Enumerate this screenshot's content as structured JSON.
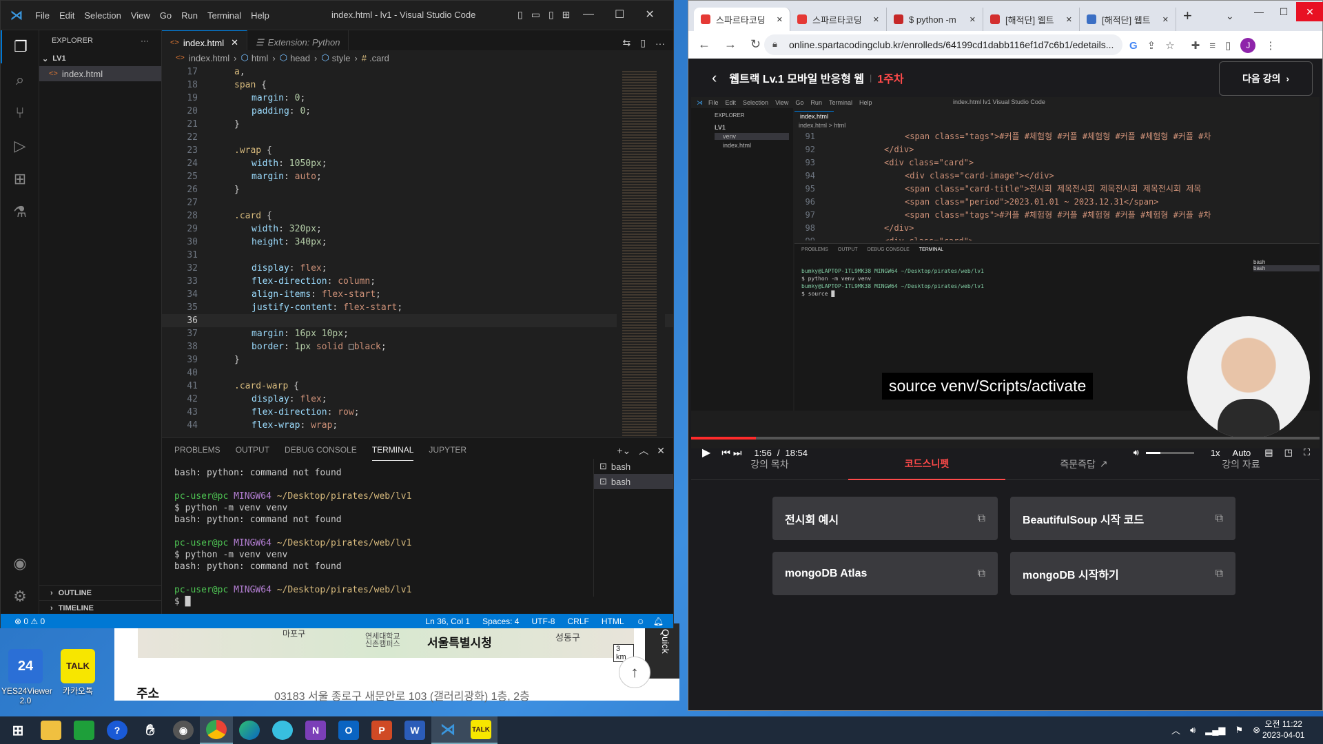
{
  "desktop": {
    "icons": [
      {
        "label": "YES24Viewer\n2.0"
      },
      {
        "label": "카카오톡"
      }
    ]
  },
  "mapwin": {
    "map_labels": [
      "마포구",
      "연세대학교\n신촌캠퍼스",
      "서울특별시청",
      "성동구",
      "3 km"
    ],
    "address_label": "주소",
    "address_value": "03183  서울 종로구 새문안로 103 (갤러리광화)  1층, 2층",
    "quick_label": "Quick"
  },
  "vscode": {
    "title": "index.html - lv1 - Visual Studio Code",
    "menu": [
      "File",
      "Edit",
      "Selection",
      "View",
      "Go",
      "Run",
      "Terminal",
      "Help"
    ],
    "explorer_label": "EXPLORER",
    "folder": "LV1",
    "file": "index.html",
    "outline": "OUTLINE",
    "timeline": "TIMELINE",
    "tabs": [
      {
        "label": "index.html"
      },
      {
        "label": "Extension: Python"
      }
    ],
    "breadcrumb": [
      "index.html",
      "html",
      "head",
      "style",
      ".card"
    ],
    "code_lines": [
      {
        "n": "17",
        "parts": [
          [
            "a",
            "sel"
          ],
          [
            ",",
            "pun"
          ]
        ],
        "indent": 1
      },
      {
        "n": "18",
        "parts": [
          [
            "span",
            "sel"
          ],
          [
            " {",
            "pun"
          ]
        ],
        "indent": 1
      },
      {
        "n": "19",
        "parts": [
          [
            "margin",
            "prop"
          ],
          [
            ": ",
            "pun"
          ],
          [
            "0",
            "num"
          ],
          [
            ";",
            "pun"
          ]
        ],
        "indent": 2
      },
      {
        "n": "20",
        "parts": [
          [
            "padding",
            "prop"
          ],
          [
            ": ",
            "pun"
          ],
          [
            "0",
            "num"
          ],
          [
            ";",
            "pun"
          ]
        ],
        "indent": 2
      },
      {
        "n": "21",
        "parts": [
          [
            "}",
            "pun"
          ]
        ],
        "indent": 1
      },
      {
        "n": "22",
        "parts": [],
        "indent": 0
      },
      {
        "n": "23",
        "parts": [
          [
            ".wrap",
            "sel"
          ],
          [
            " {",
            "pun"
          ]
        ],
        "indent": 1
      },
      {
        "n": "24",
        "parts": [
          [
            "width",
            "prop"
          ],
          [
            ": ",
            "pun"
          ],
          [
            "1050px",
            "num"
          ],
          [
            ";",
            "pun"
          ]
        ],
        "indent": 2
      },
      {
        "n": "25",
        "parts": [
          [
            "margin",
            "prop"
          ],
          [
            ": ",
            "pun"
          ],
          [
            "auto",
            "val"
          ],
          [
            ";",
            "pun"
          ]
        ],
        "indent": 2
      },
      {
        "n": "26",
        "parts": [
          [
            "}",
            "pun"
          ]
        ],
        "indent": 1
      },
      {
        "n": "27",
        "parts": [],
        "indent": 0
      },
      {
        "n": "28",
        "parts": [
          [
            ".card",
            "sel"
          ],
          [
            " {",
            "pun"
          ]
        ],
        "indent": 1
      },
      {
        "n": "29",
        "parts": [
          [
            "width",
            "prop"
          ],
          [
            ": ",
            "pun"
          ],
          [
            "320px",
            "num"
          ],
          [
            ";",
            "pun"
          ]
        ],
        "indent": 2
      },
      {
        "n": "30",
        "parts": [
          [
            "height",
            "prop"
          ],
          [
            ": ",
            "pun"
          ],
          [
            "340px",
            "num"
          ],
          [
            ";",
            "pun"
          ]
        ],
        "indent": 2
      },
      {
        "n": "31",
        "parts": [],
        "indent": 0
      },
      {
        "n": "32",
        "parts": [
          [
            "display",
            "prop"
          ],
          [
            ": ",
            "pun"
          ],
          [
            "flex",
            "val"
          ],
          [
            ";",
            "pun"
          ]
        ],
        "indent": 2
      },
      {
        "n": "33",
        "parts": [
          [
            "flex-direction",
            "prop"
          ],
          [
            ": ",
            "pun"
          ],
          [
            "column",
            "val"
          ],
          [
            ";",
            "pun"
          ]
        ],
        "indent": 2
      },
      {
        "n": "34",
        "parts": [
          [
            "align-items",
            "prop"
          ],
          [
            ": ",
            "pun"
          ],
          [
            "flex-start",
            "val"
          ],
          [
            ";",
            "pun"
          ]
        ],
        "indent": 2
      },
      {
        "n": "35",
        "parts": [
          [
            "justify-content",
            "prop"
          ],
          [
            ": ",
            "pun"
          ],
          [
            "flex-start",
            "val"
          ],
          [
            ";",
            "pun"
          ]
        ],
        "indent": 2
      },
      {
        "n": "36",
        "parts": [],
        "indent": 0
      },
      {
        "n": "37",
        "parts": [
          [
            "margin",
            "prop"
          ],
          [
            ": ",
            "pun"
          ],
          [
            "16px 10px",
            "num"
          ],
          [
            ";",
            "pun"
          ]
        ],
        "indent": 2
      },
      {
        "n": "38",
        "parts": [
          [
            "border",
            "prop"
          ],
          [
            ": ",
            "pun"
          ],
          [
            "1px",
            "num"
          ],
          [
            " solid ",
            "val"
          ],
          [
            "□",
            "pun"
          ],
          [
            "black",
            "val"
          ],
          [
            ";",
            "pun"
          ]
        ],
        "indent": 2
      },
      {
        "n": "39",
        "parts": [
          [
            "}",
            "pun"
          ]
        ],
        "indent": 1
      },
      {
        "n": "40",
        "parts": [],
        "indent": 0
      },
      {
        "n": "41",
        "parts": [
          [
            ".card-warp",
            "sel"
          ],
          [
            " {",
            "pun"
          ]
        ],
        "indent": 1
      },
      {
        "n": "42",
        "parts": [
          [
            "display",
            "prop"
          ],
          [
            ": ",
            "pun"
          ],
          [
            "flex",
            "val"
          ],
          [
            ";",
            "pun"
          ]
        ],
        "indent": 2
      },
      {
        "n": "43",
        "parts": [
          [
            "flex-direction",
            "prop"
          ],
          [
            ": ",
            "pun"
          ],
          [
            "row",
            "val"
          ],
          [
            ";",
            "pun"
          ]
        ],
        "indent": 2
      },
      {
        "n": "44",
        "parts": [
          [
            "flex-wrap",
            "prop"
          ],
          [
            ": ",
            "pun"
          ],
          [
            "wrap",
            "val"
          ],
          [
            ";",
            "pun"
          ]
        ],
        "indent": 2
      }
    ],
    "panel_tabs": [
      "PROBLEMS",
      "OUTPUT",
      "DEBUG CONSOLE",
      "TERMINAL",
      "JUPYTER"
    ],
    "active_panel_tab": "TERMINAL",
    "terminal": [
      {
        "type": "out",
        "text": "bash: python: command not found"
      },
      {
        "type": "blank"
      },
      {
        "type": "prompt",
        "user": "pc-user@pc",
        "host": "MINGW64",
        "path": "~/Desktop/pirates/web/lv1"
      },
      {
        "type": "out",
        "text": "$ python -m venv venv"
      },
      {
        "type": "out",
        "text": "bash: python: command not found"
      },
      {
        "type": "blank"
      },
      {
        "type": "prompt",
        "user": "pc-user@pc",
        "host": "MINGW64",
        "path": "~/Desktop/pirates/web/lv1"
      },
      {
        "type": "out",
        "text": "$ python -m venv venv"
      },
      {
        "type": "out",
        "text": "bash: python: command not found"
      },
      {
        "type": "blank"
      },
      {
        "type": "prompt",
        "user": "pc-user@pc",
        "host": "MINGW64",
        "path": "~/Desktop/pirates/web/lv1"
      },
      {
        "type": "out",
        "text": "$ █"
      }
    ],
    "terminal_list": [
      "bash",
      "bash"
    ],
    "status": {
      "errors": "⊗ 0 ⚠ 0",
      "position": "Ln 36, Col 1",
      "spaces": "Spaces: 4",
      "encoding": "UTF-8",
      "eol": "CRLF",
      "language": "HTML"
    }
  },
  "chrome": {
    "tabs": [
      "스파르타코딩",
      "스파르타코딩",
      "$ python -m",
      "[해적단] 웹트",
      "[해적단] 웹트"
    ],
    "url": "online.spartacodingclub.kr/enrolleds/64199cd1dabb116ef1d7c6b1/edetails...",
    "profile": "J"
  },
  "lecture": {
    "title": "웹트랙 Lv.1 모바일 반응형 웹",
    "week": "1주차",
    "next_label": "다음 강의",
    "subtitle": "source venv/Scripts/activate",
    "time_current": "1:56",
    "time_total": "18:54",
    "progress": 0.103,
    "speed": "1x",
    "quality": "Auto",
    "tabs": [
      "강의 목차",
      "코드스니펫",
      "즉문즉답",
      "강의 자료"
    ],
    "active_tab": "코드스니펫",
    "snippets": [
      "전시회 예시",
      "BeautifulSoup 시작 코드",
      "mongoDB Atlas",
      "mongoDB 시작하기"
    ],
    "inner_vscode": {
      "title": "index.html   lv1   Visual Studio Code",
      "menu": [
        "File",
        "Edit",
        "Selection",
        "View",
        "Go",
        "Run",
        "Terminal",
        "Help"
      ],
      "explorer": "EXPLORER",
      "folder": "LV1",
      "items": [
        "venv",
        "index.html"
      ],
      "tab": "index.html",
      "crumb": "index.html > html",
      "code": [
        {
          "n": "91",
          "t": "<span class=\"tags\">#커플 #체험형 #커플 #체험형 #커플 #체험형 #커플 #차"
        },
        {
          "n": "92",
          "t": "</div>"
        },
        {
          "n": "93",
          "t": "<div class=\"card\">"
        },
        {
          "n": "94",
          "t": "<div class=\"card-image\"></div>"
        },
        {
          "n": "95",
          "t": "<span class=\"card-title\">전시회 제목전시회 제목전시회 제목전시회 제목"
        },
        {
          "n": "96",
          "t": "<span class=\"period\">2023.01.01 ~ 2023.12.31</span>"
        },
        {
          "n": "97",
          "t": "<span class=\"tags\">#커플 #체험형 #커플 #체험형 #커플 #체험형 #커플 #차"
        },
        {
          "n": "98",
          "t": "</div>"
        },
        {
          "n": "99",
          "t": "<div class=\"card\">"
        }
      ],
      "panel_tabs": [
        "PROBLEMS",
        "OUTPUT",
        "DEBUG CONSOLE",
        "TERMINAL"
      ],
      "term": [
        "bumky@LAPTOP-1TL9MK38 MINGW64 ~/Desktop/pirates/web/lv1",
        "$ python -m venv venv",
        "",
        "bumky@LAPTOP-1TL9MK38 MINGW64 ~/Desktop/pirates/web/lv1",
        "$ source █"
      ],
      "term_list": [
        "bash",
        "bash"
      ]
    }
  },
  "taskbar": {
    "time": "오전 11:22",
    "date": "2023-04-01",
    "apps": [
      "start",
      "explorer",
      "store",
      "help",
      "hand",
      "camera",
      "chrome",
      "edge",
      "app",
      "onenote",
      "outlook",
      "powerpoint",
      "word",
      "vscode",
      "kakaotalk"
    ]
  }
}
